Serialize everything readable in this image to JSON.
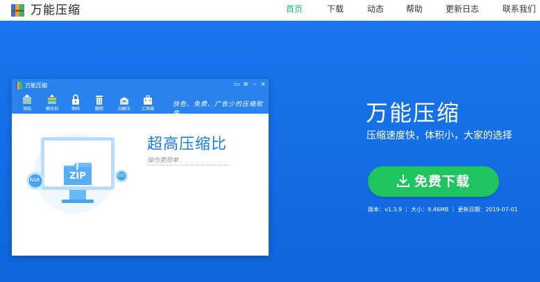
{
  "site": {
    "name": "万能压缩"
  },
  "nav": [
    {
      "label": "首页",
      "active": true
    },
    {
      "label": "下载",
      "active": false
    },
    {
      "label": "动态",
      "active": false
    },
    {
      "label": "帮助",
      "active": false
    },
    {
      "label": "更新日志",
      "active": false
    },
    {
      "label": "联系我们",
      "active": false
    }
  ],
  "app_window": {
    "title": "万能压缩",
    "toolbar": [
      {
        "label": "添加",
        "icon": "add-icon"
      },
      {
        "label": "解压到",
        "icon": "extract-to-icon"
      },
      {
        "label": "密码",
        "icon": "lock-icon"
      },
      {
        "label": "删除",
        "icon": "trash-icon"
      },
      {
        "label": "向解压",
        "icon": "unzip-icon"
      },
      {
        "label": "工具箱",
        "icon": "toolbox-icon"
      }
    ],
    "slogan": "快色、免费、广告少的压缩软件",
    "headline": "超高压缩比",
    "subline": "操作更简单",
    "badges": {
      "left": "RAR",
      "center": "ZIP",
      "right": "GO"
    }
  },
  "hero": {
    "title": "万能压缩",
    "subtitle": "压缩速度快，体积小，大家的选择",
    "download_label": "免费下载",
    "meta": "版本：v1.3.9 ｜ 大小：9.46MB ｜ 更新日期：2019-07-01"
  },
  "colors": {
    "hero_blue": "#1a76ee",
    "accent_green": "#1ec45e",
    "nav_active": "#1db866"
  }
}
